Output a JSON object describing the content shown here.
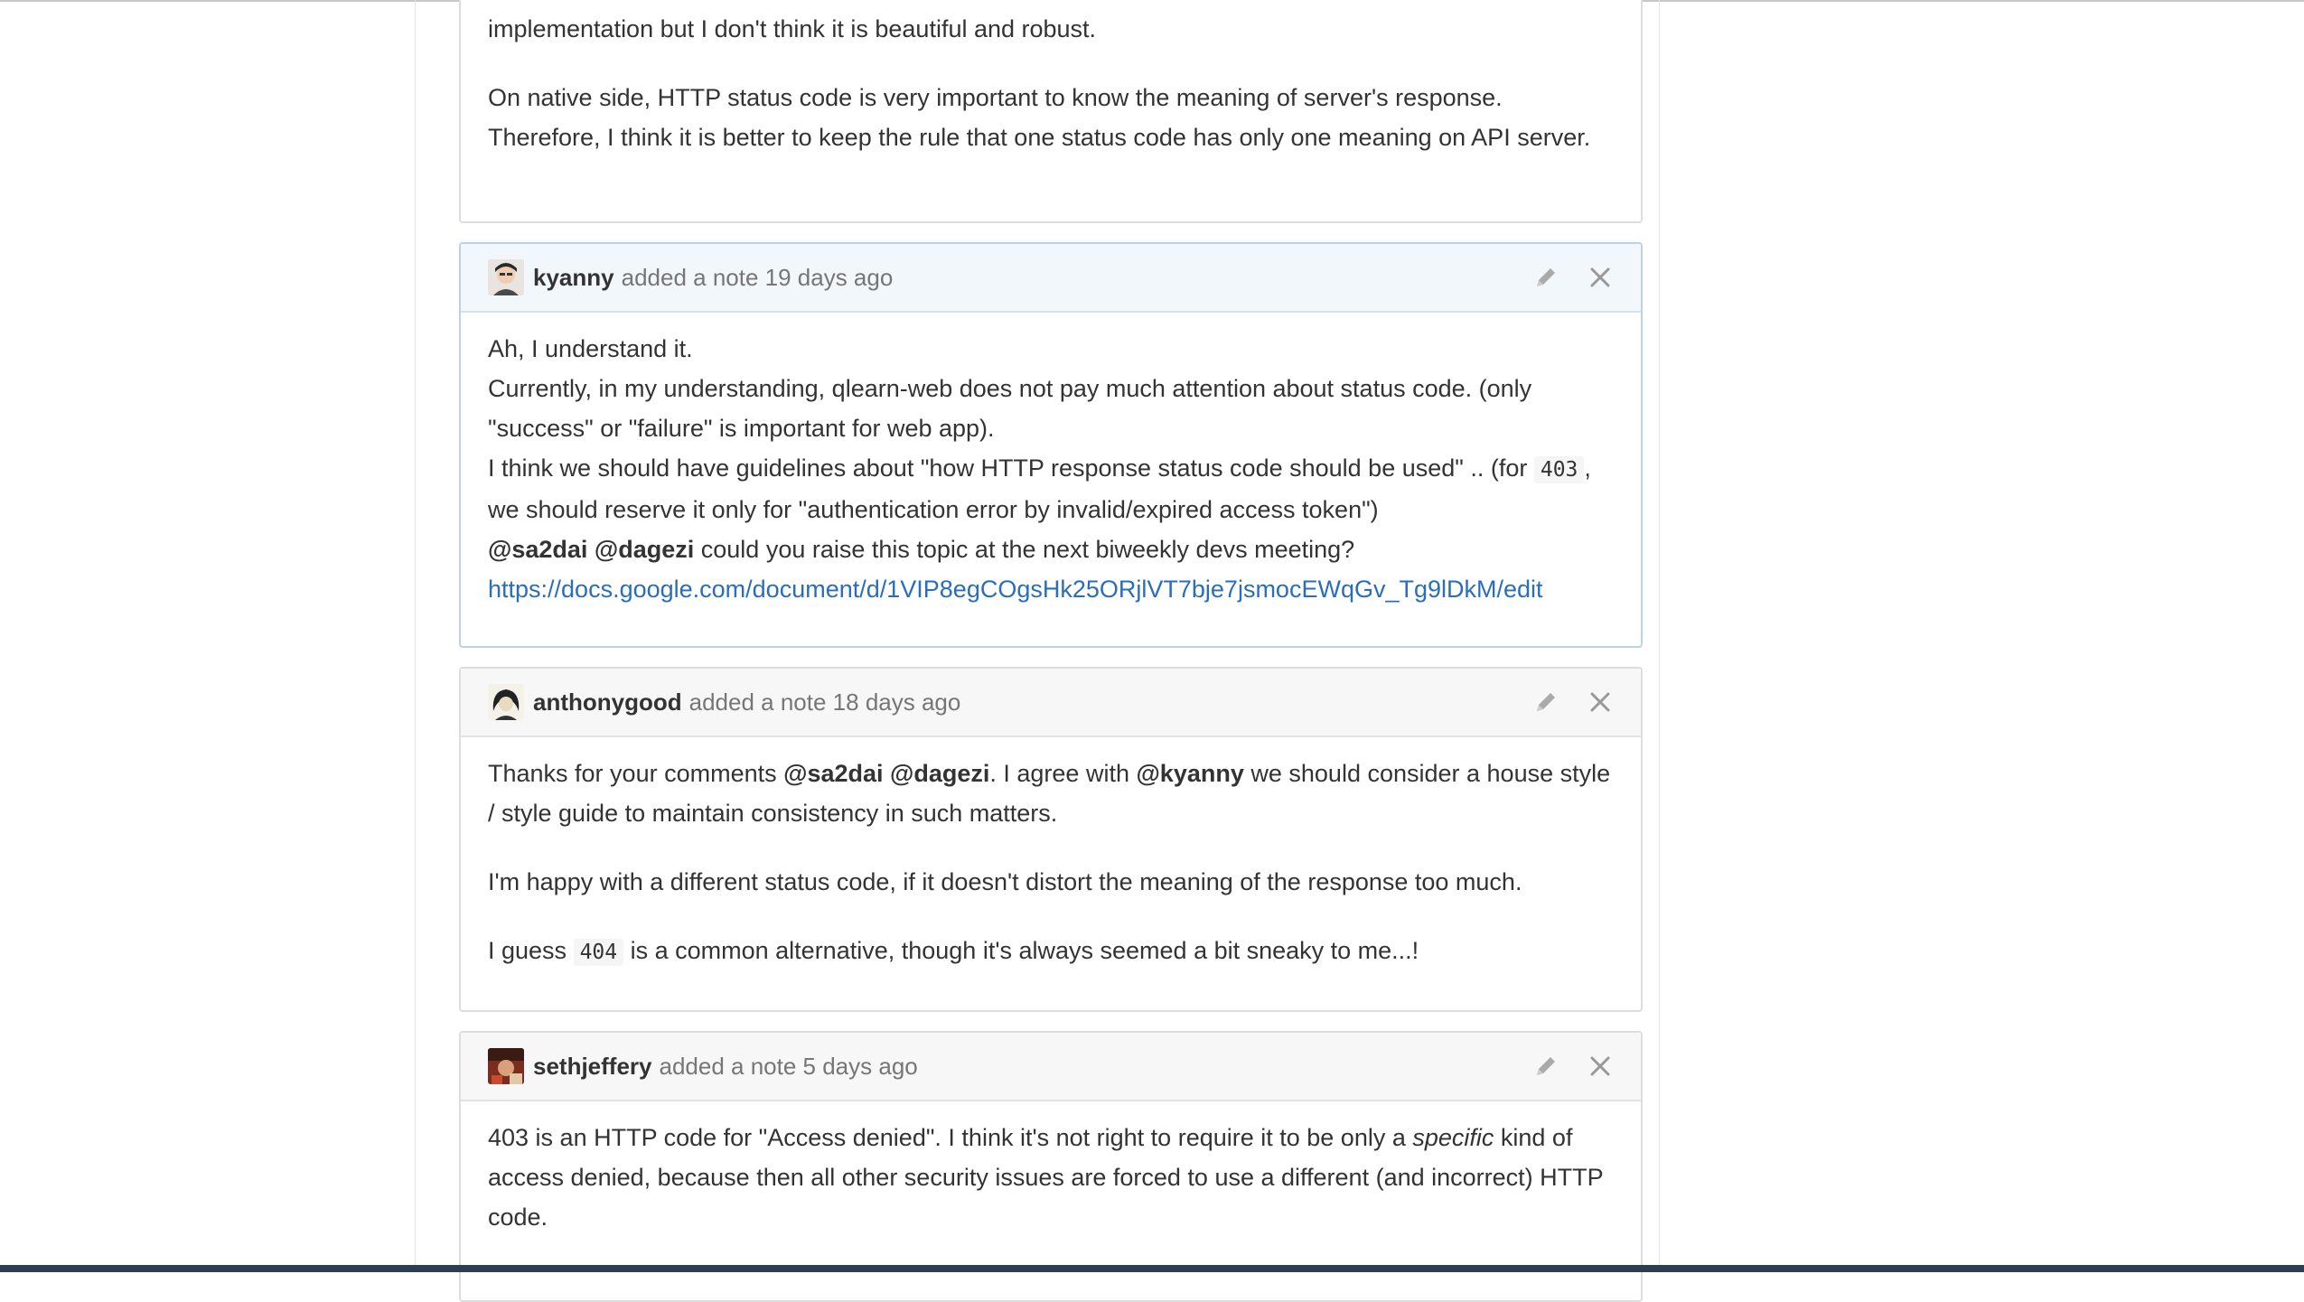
{
  "note0": {
    "para1": "implementation but I don't think it is beautiful and robust.",
    "para2": "On native side, HTTP status code is very important to know the meaning of server's response. Therefore, I think it is better to keep the rule that one status code has only one meaning on API server."
  },
  "note1": {
    "author": "kyanny",
    "meta": "added a note 19 days ago",
    "avatar_icon": "user-avatar",
    "edit_icon": "pencil-icon",
    "close_icon": "close-icon",
    "line1": "Ah, I understand it.",
    "line2": "Currently, in my understanding, qlearn-web does not pay much attention about status code. (only \"success\" or \"failure\" is important for web app).",
    "line3_pre": "I think we should have guidelines about \"how HTTP response status code should be used\" .. (for ",
    "line3_code": "403",
    "line3_post": ", we should reserve it only for \"authentication error by invalid/expired access token\")",
    "mention1": "@sa2dai",
    "mention2": "@dagezi",
    "line4_post": " could you raise this topic at the next biweekly devs meeting?",
    "link": "https://docs.google.com/document/d/1VIP8egCOgsHk25ORjlVT7bje7jsmocEWqGv_Tg9lDkM/edit"
  },
  "note2": {
    "author": "anthonygood",
    "meta": "added a note 18 days ago",
    "p1_pre": "Thanks for your comments ",
    "p1_mention1": "@sa2dai",
    "p1_mention2": "@dagezi",
    "p1_mid": ". I agree with ",
    "p1_mention3": "@kyanny",
    "p1_post": " we should consider a house style / style guide to maintain consistency in such matters.",
    "p2": "I'm happy with a different status code, if it doesn't distort the meaning of the response too much.",
    "p3_pre": "I guess ",
    "p3_code": "404",
    "p3_post": " is a common alternative, though it's always seemed a bit sneaky to me...!"
  },
  "note3": {
    "author": "sethjeffery",
    "meta": "added a note 5 days ago",
    "p1_pre": "403 is an HTTP code for \"Access denied\". I think it's not right to require it to be only a ",
    "p1_em": "specific",
    "p1_post": " kind of access denied, because then all other security issues are forced to use a different (and incorrect) HTTP code."
  },
  "colors": {
    "link": "#2a6ebb",
    "highlight_header": "#f2f7fb",
    "header": "#f7f7f7"
  }
}
